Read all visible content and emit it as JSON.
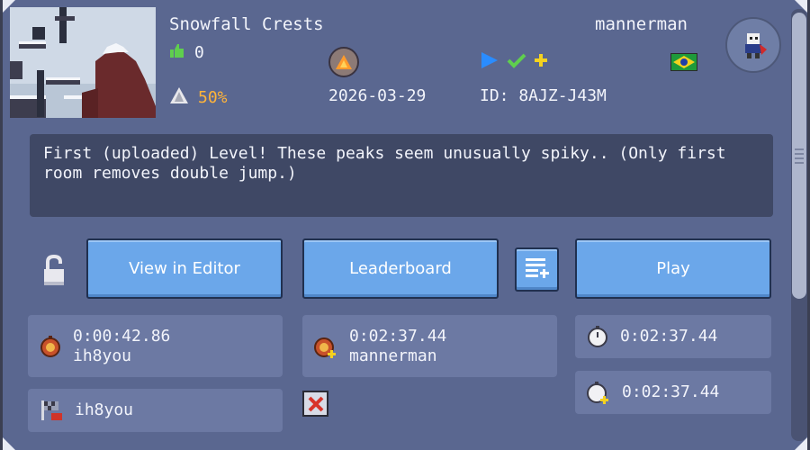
{
  "level": {
    "title": "Snowfall Crests",
    "likes": "0",
    "clear_rate": "50%",
    "date": "2026-03-29",
    "id": "ID: 8AJZ-J43M",
    "author": "mannerman",
    "description": "First (uploaded) Level! These peaks seem unusually spiky.. (Only first room removes double jump.)",
    "country_flag": "brazil-flag"
  },
  "buttons": {
    "view_in_editor": "View in Editor",
    "leaderboard": "Leaderboard",
    "play": "Play"
  },
  "records": {
    "world_record": {
      "time": "0:00:42.86",
      "player": "ih8you"
    },
    "first_clear": {
      "player": "ih8you"
    },
    "personal_best": {
      "time": "0:02:37.44",
      "player": "mannerman"
    },
    "timer_total": "0:02:37.44",
    "timer_plus": "0:02:37.44"
  },
  "colors": {
    "panel": "#5a6790",
    "button": "#6ba7ea",
    "clear_rate": "#ffb43a",
    "description_bg": "#3f4865"
  },
  "icons": [
    "thumbs-up-icon",
    "warning-triangle-icon",
    "difficulty-badge-icon",
    "play-triangle-icon",
    "check-plus-icon",
    "lock-open-icon",
    "add-to-list-icon",
    "stopwatch-icon",
    "trophy-flag-icon",
    "close-icon"
  ]
}
